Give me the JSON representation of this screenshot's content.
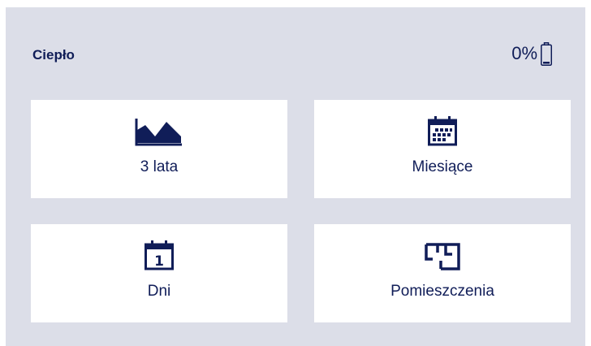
{
  "header": {
    "title": "Ciepło",
    "battery_percent": "0%",
    "battery_icon": "battery-icon"
  },
  "tiles": [
    {
      "label": "3 lata",
      "icon": "area-chart-icon"
    },
    {
      "label": "Miesiące",
      "icon": "calendar-month-icon"
    },
    {
      "label": "Dni",
      "icon": "calendar-day-icon",
      "icon_text": "1"
    },
    {
      "label": "Pomieszczenia",
      "icon": "floor-plan-icon"
    }
  ],
  "colors": {
    "background": "#dcdee8",
    "tile": "#ffffff",
    "text": "#101d58"
  }
}
